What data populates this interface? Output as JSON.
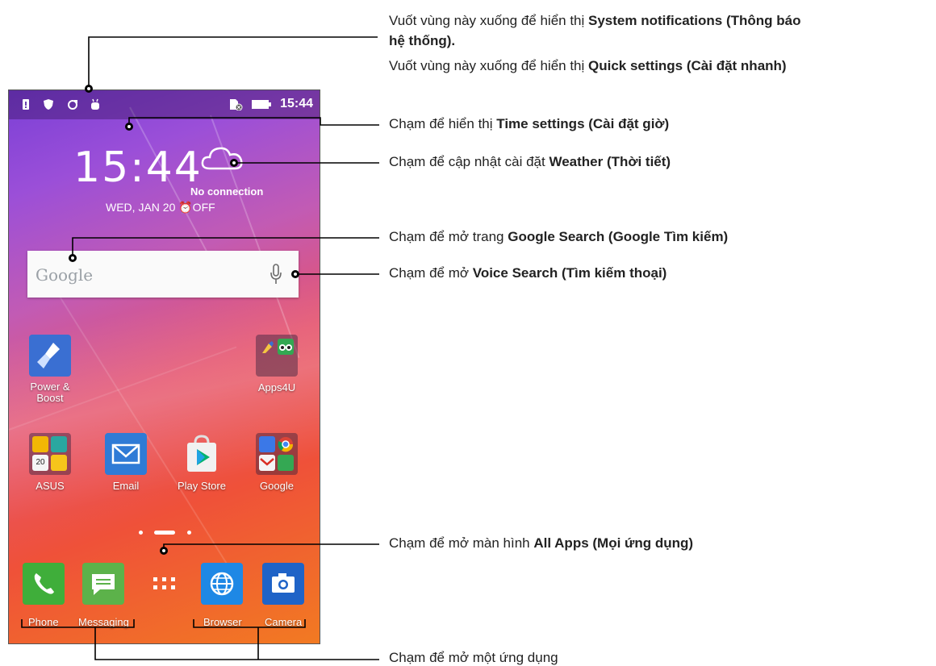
{
  "status_bar": {
    "time": "15:44",
    "icons": [
      "battery-alert-icon",
      "shield-icon",
      "sync-icon",
      "android-debug-icon",
      "sim-card-icon",
      "battery-icon"
    ]
  },
  "home": {
    "clock": "15:44",
    "date": "WED, JAN 20 ⏰OFF",
    "weather_status": "No connection",
    "search_placeholder": "Google",
    "apps": [
      {
        "label": "Power &\nBoost"
      },
      {
        "label": "Apps4U"
      },
      {
        "label": "ASUS"
      },
      {
        "label": "Email"
      },
      {
        "label": "Play Store"
      },
      {
        "label": "Google"
      }
    ],
    "dock": [
      {
        "label": "Phone"
      },
      {
        "label": "Messaging"
      },
      {
        "label": "Browser"
      },
      {
        "label": "Camera"
      }
    ]
  },
  "callouts": {
    "notif_line1_a": "Vuốt vùng này xuống để hiển thị ",
    "notif_line1_b": "System notifications (Thông báo",
    "notif_line2": "hệ thống).",
    "quick_a": "Vuốt vùng này xuống để hiển thị ",
    "quick_b": "Quick settings (Cài đặt nhanh)",
    "time_a": "Chạm để hiển thị ",
    "time_b": "Time settings (Cài đặt giờ)",
    "weather_a": "Chạm để cập nhật cài đặt ",
    "weather_b": "Weather (Thời tiết)",
    "gsearch_a": "Chạm để mở trang ",
    "gsearch_b": "Google Search (Google Tìm kiếm)",
    "voice_a": "Chạm để mở ",
    "voice_b": "Voice Search (Tìm kiếm thoại)",
    "allapps_a": "Chạm để mở màn hình ",
    "allapps_b": "All Apps (Mọi ứng dụng)",
    "openapp": "Chạm để mở một ứng dụng"
  },
  "colors": {
    "email": "#2f7bd6",
    "phone": "#3fae3a",
    "messaging": "#5cb24a",
    "browser": "#1e88e5",
    "camera": "#1f63c7",
    "power_boost": "#3a6fd2"
  }
}
